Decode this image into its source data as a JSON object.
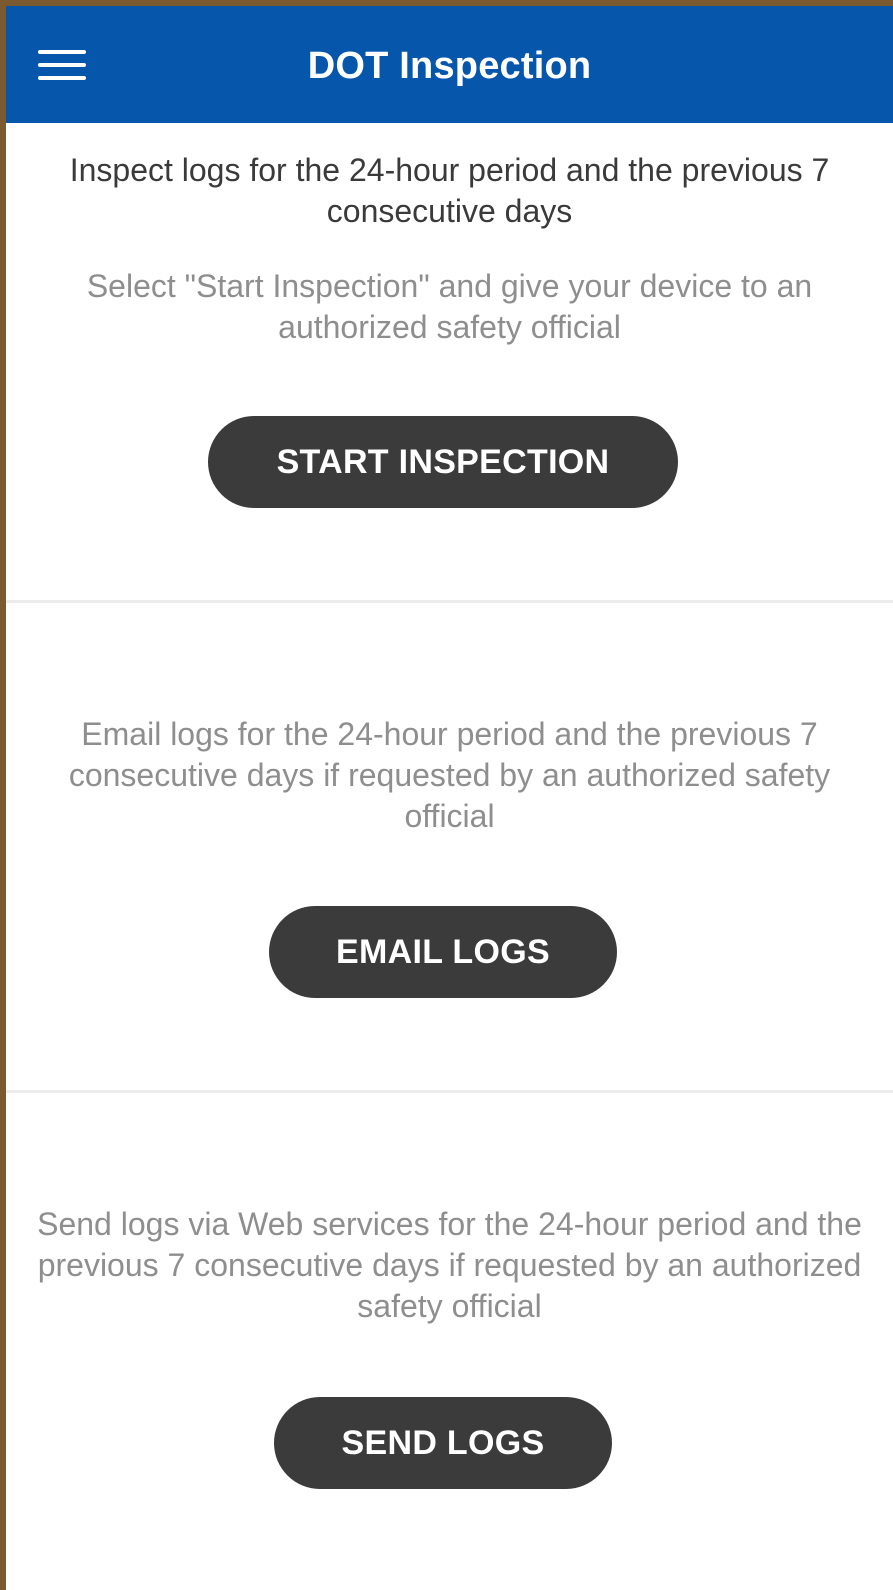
{
  "header": {
    "title": "DOT Inspection",
    "menu_icon": "hamburger-menu-icon",
    "background_color": "#0657ac"
  },
  "inspection": {
    "primary_text": "Inspect logs for the 24-hour period and the previous 7 consecutive days",
    "secondary_text": "Select \"Start Inspection\" and give your device to an authorized safety official",
    "button_label": "START INSPECTION"
  },
  "email": {
    "text": "Email logs for the 24-hour period and the previous 7 consecutive days if requested by an authorized safety official",
    "button_label": "EMAIL LOGS"
  },
  "send": {
    "text": "Send logs via Web services for the 24-hour period and the previous 7 consecutive days if requested by an authorized safety official",
    "button_label": "SEND LOGS"
  },
  "colors": {
    "button": "#3b3b3b",
    "muted_text": "#8e8e8e"
  }
}
